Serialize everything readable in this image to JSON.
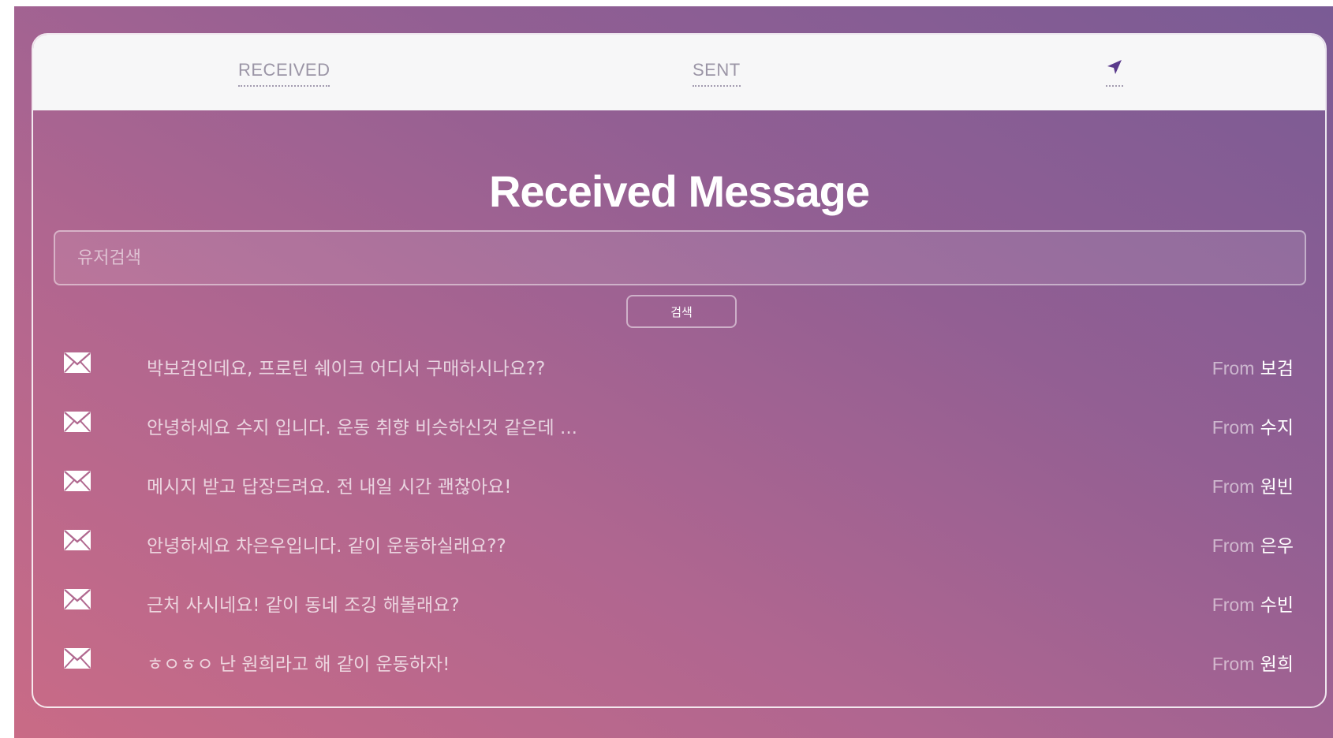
{
  "tabs": {
    "received": "RECEIVED",
    "sent": "SENT",
    "send_icon": "paper-plane-icon"
  },
  "page_title": "Received Message",
  "search": {
    "placeholder": "유저검색",
    "button_label": "검색"
  },
  "messages": [
    {
      "icon": "envelope-icon",
      "text": "박보검인데요, 프로틴 쉐이크 어디서 구매하시나요??",
      "from_prefix": "From",
      "sender": "보검"
    },
    {
      "icon": "envelope-icon",
      "text": "안녕하세요 수지 입니다. 운동 취향 비슷하신것 같은데 ...",
      "from_prefix": "From",
      "sender": "수지"
    },
    {
      "icon": "envelope-icon",
      "text": "메시지 받고 답장드려요. 전 내일 시간 괜찮아요!",
      "from_prefix": "From",
      "sender": "원빈"
    },
    {
      "icon": "envelope-icon",
      "text": "안녕하세요 차은우입니다. 같이 운동하실래요??",
      "from_prefix": "From",
      "sender": "은우"
    },
    {
      "icon": "envelope-icon",
      "text": "근처 사시네요! 같이 동네 조깅 해볼래요?",
      "from_prefix": "From",
      "sender": "수빈"
    },
    {
      "icon": "envelope-icon",
      "text": "ㅎㅇㅎㅇ 난 원희라고 해 같이 운동하자!",
      "from_prefix": "From",
      "sender": "원희"
    }
  ],
  "colors": {
    "tab_text": "#9b95a6",
    "send_icon": "#5a3a8c",
    "gradient_start": "#c96b86",
    "gradient_end": "#7a5b95"
  }
}
